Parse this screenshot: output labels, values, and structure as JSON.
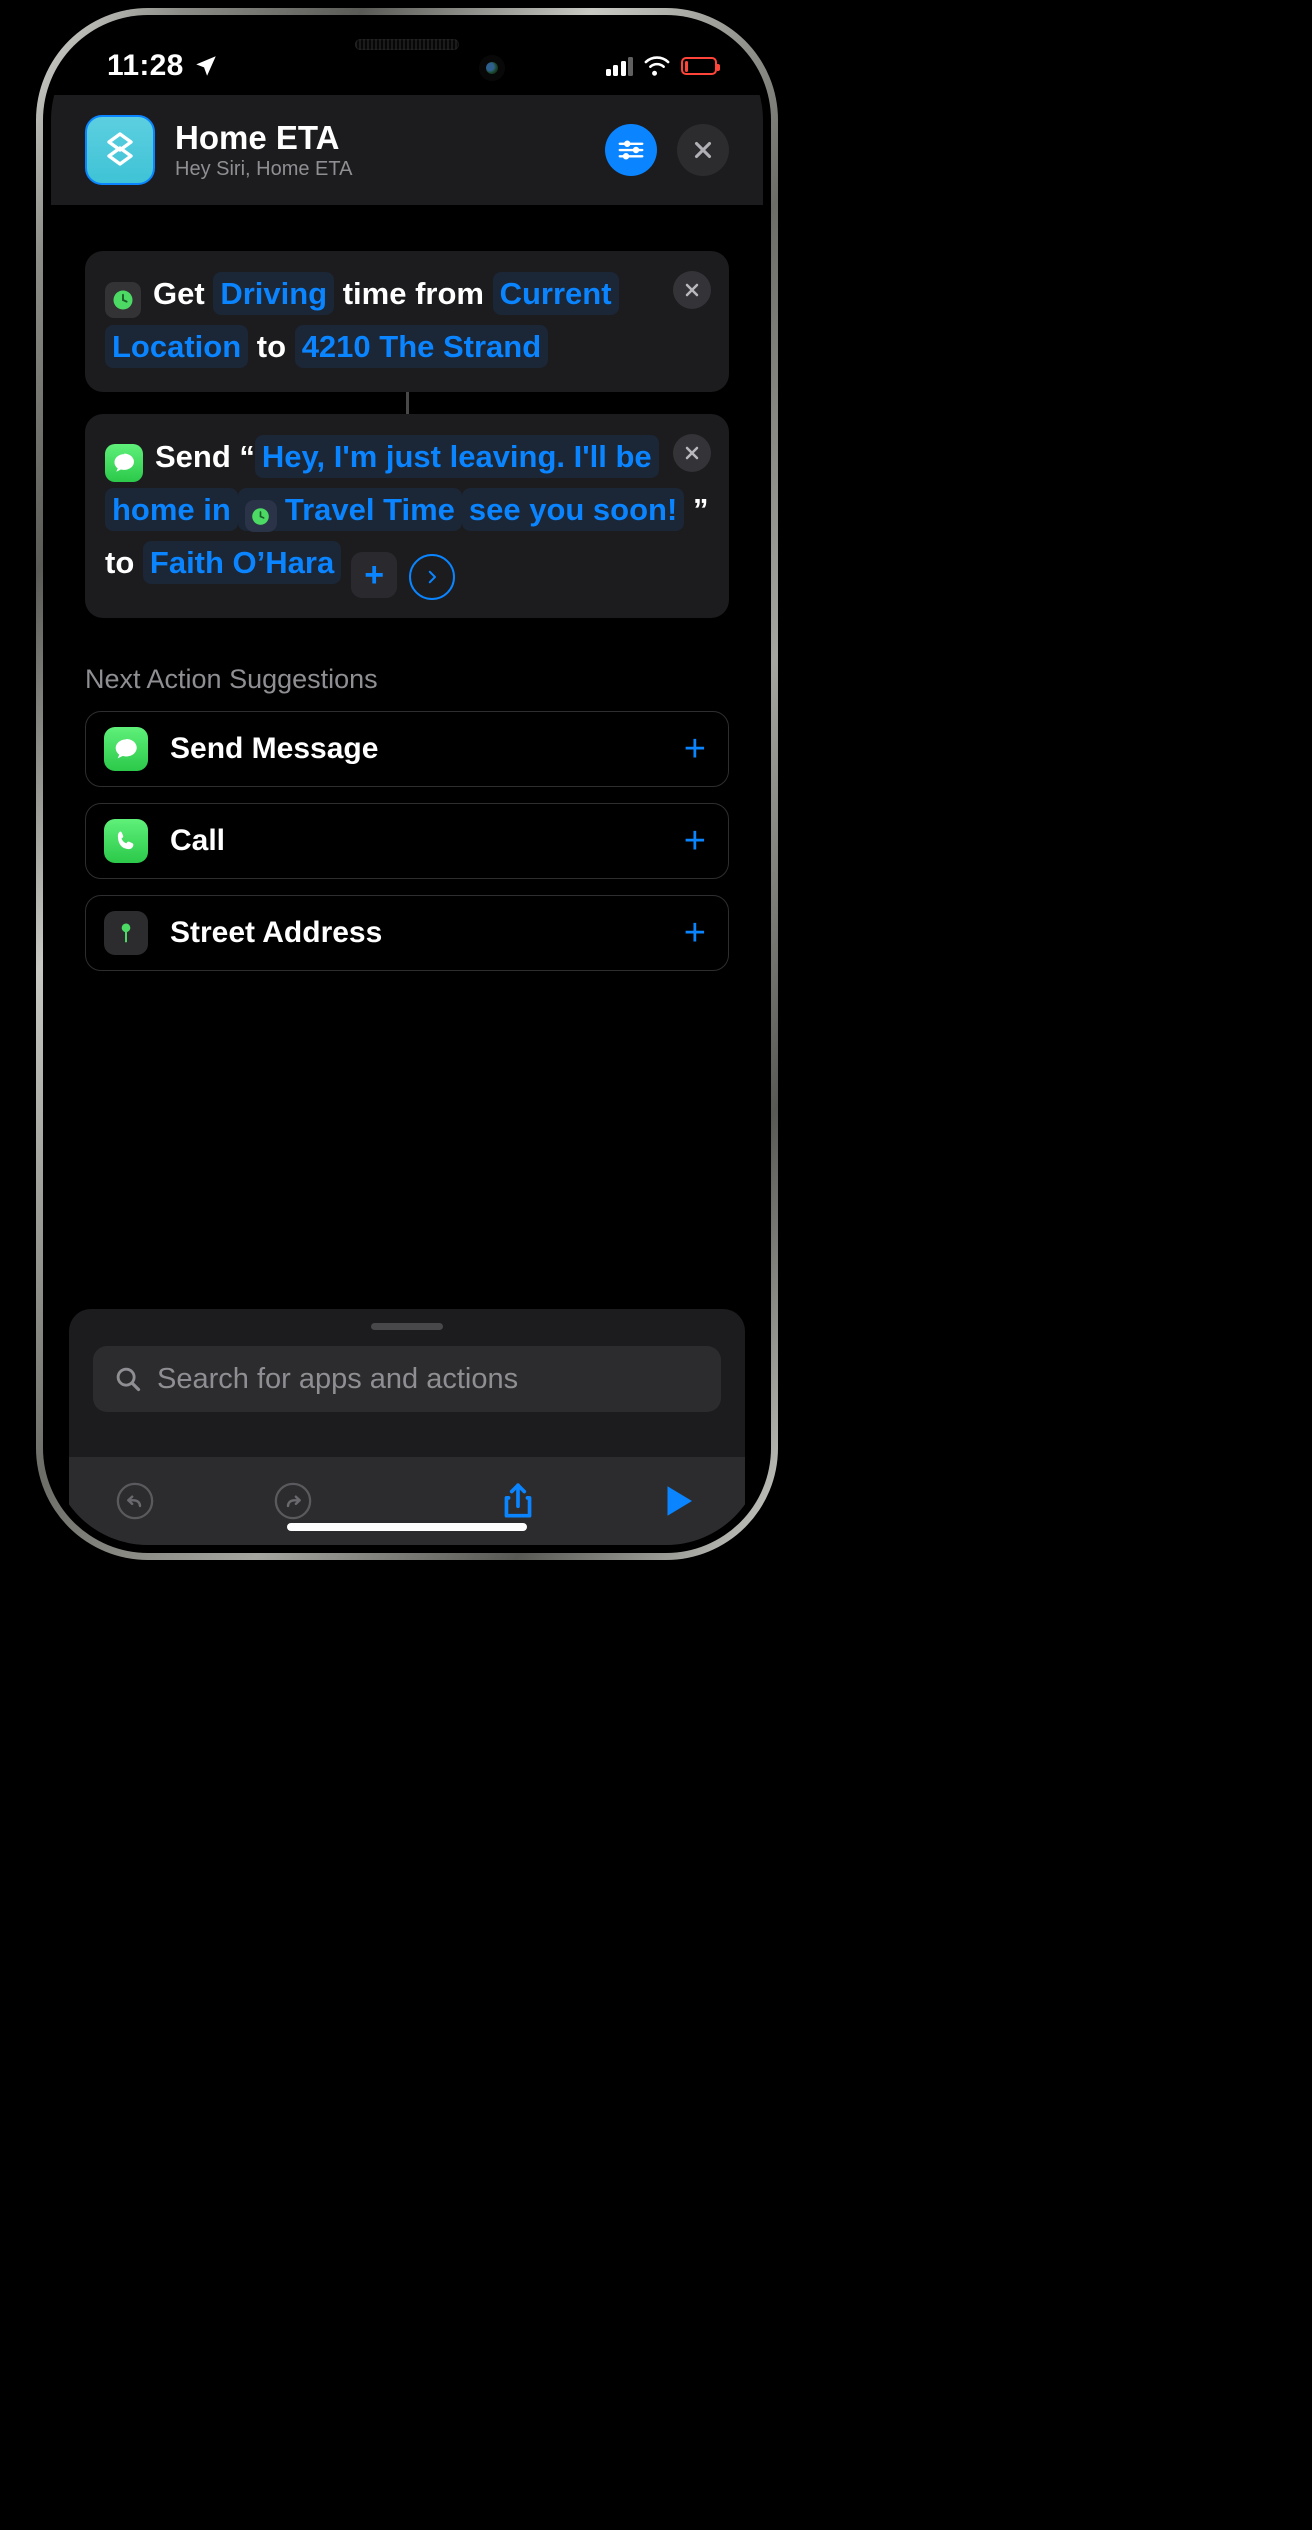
{
  "status_bar": {
    "time": "11:28",
    "location_icon": "location-arrow-icon",
    "cellular_icon": "cellular-bars-icon",
    "wifi_icon": "wifi-icon",
    "battery_icon": "battery-low-icon",
    "battery_color": "#ff453a"
  },
  "header": {
    "title": "Home ETA",
    "subtitle": "Hey Siri, Home ETA",
    "app_icon": "shortcuts-icon",
    "settings_icon": "sliders-icon",
    "close_icon": "close-x-icon",
    "accent": "#0a84ff",
    "icon_color": "#4ecbdc"
  },
  "actions": [
    {
      "icon": "clock-green-icon",
      "segments": [
        {
          "text": "Get",
          "style": "plain"
        },
        {
          "text": "Driving",
          "style": "token"
        },
        {
          "text": "time from",
          "style": "plain"
        },
        {
          "text": "Current Location",
          "style": "token"
        },
        {
          "text": "to",
          "style": "plain"
        },
        {
          "text": "4210 The Strand",
          "style": "token"
        }
      ],
      "remove_label": "×"
    },
    {
      "icon": "messages-icon",
      "segments": [
        {
          "text": "Send",
          "style": "plain"
        },
        {
          "text": "“",
          "style": "plain"
        },
        {
          "text": "Hey, I'm just leaving. I'll be home in",
          "style": "token"
        },
        {
          "text": "Travel Time",
          "style": "token-icon"
        },
        {
          "text": "see you soon!",
          "style": "token"
        },
        {
          "text": "”",
          "style": "plain"
        },
        {
          "text": "to",
          "style": "plain"
        },
        {
          "text": "Faith O’Hara",
          "style": "token"
        }
      ],
      "add_label": "+",
      "chevron_label": "›",
      "remove_label": "×"
    }
  ],
  "suggestions": {
    "title": "Next Action Suggestions",
    "items": [
      {
        "label": "Send Message",
        "icon": "messages-icon",
        "icon_style": "green",
        "add_label": "+"
      },
      {
        "label": "Call",
        "icon": "phone-icon",
        "icon_style": "green",
        "add_label": "+"
      },
      {
        "label": "Street Address",
        "icon": "map-pin-icon",
        "icon_style": "grey",
        "add_label": "+"
      }
    ]
  },
  "search": {
    "placeholder": "Search for apps and actions",
    "icon": "search-icon"
  },
  "toolbar": {
    "undo_icon": "undo-icon",
    "redo_icon": "redo-icon",
    "share_icon": "share-icon",
    "play_icon": "play-icon",
    "accent": "#0a84ff"
  }
}
